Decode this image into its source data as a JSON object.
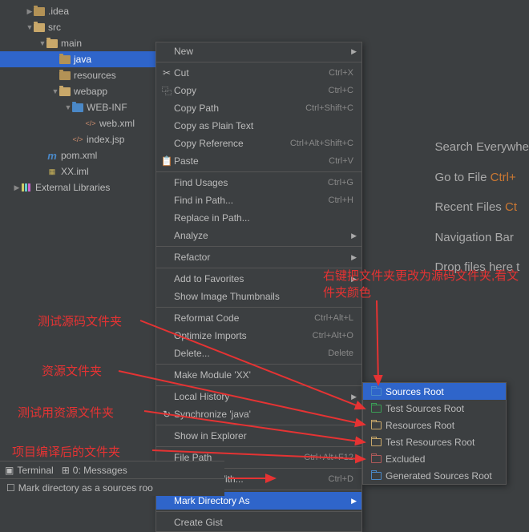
{
  "tree": [
    {
      "indent": 2,
      "chev": "▶",
      "icon": "folder-closed",
      "label": ".idea"
    },
    {
      "indent": 2,
      "chev": "▼",
      "icon": "folder",
      "label": "src"
    },
    {
      "indent": 3,
      "chev": "▼",
      "icon": "folder",
      "label": "main"
    },
    {
      "indent": 4,
      "chev": "",
      "icon": "folder-closed",
      "label": "java",
      "selected": true
    },
    {
      "indent": 4,
      "chev": "",
      "icon": "folder-closed",
      "label": "resources"
    },
    {
      "indent": 4,
      "chev": "▼",
      "icon": "folder",
      "label": "webapp"
    },
    {
      "indent": 5,
      "chev": "▼",
      "icon": "folder-blue",
      "label": "WEB-INF"
    },
    {
      "indent": 6,
      "chev": "",
      "icon": "xml",
      "label": "web.xml"
    },
    {
      "indent": 5,
      "chev": "",
      "icon": "xml",
      "label": "index.jsp"
    },
    {
      "indent": 3,
      "chev": "",
      "icon": "maven",
      "label": "pom.xml"
    },
    {
      "indent": 3,
      "chev": "",
      "icon": "iml",
      "label": "XX.iml"
    },
    {
      "indent": 1,
      "chev": "▶",
      "icon": "lib",
      "label": "External Libraries"
    }
  ],
  "menu": [
    {
      "t": "item",
      "label": "New",
      "arrow": true
    },
    {
      "t": "sep"
    },
    {
      "t": "item",
      "icon": "✂",
      "label": "Cut",
      "short": "Ctrl+X"
    },
    {
      "t": "item",
      "icon": "⿻",
      "label": "Copy",
      "short": "Ctrl+C"
    },
    {
      "t": "item",
      "label": "Copy Path",
      "short": "Ctrl+Shift+C"
    },
    {
      "t": "item",
      "label": "Copy as Plain Text"
    },
    {
      "t": "item",
      "label": "Copy Reference",
      "short": "Ctrl+Alt+Shift+C"
    },
    {
      "t": "item",
      "icon": "📋",
      "label": "Paste",
      "short": "Ctrl+V"
    },
    {
      "t": "sep"
    },
    {
      "t": "item",
      "label": "Find Usages",
      "short": "Ctrl+G"
    },
    {
      "t": "item",
      "label": "Find in Path...",
      "short": "Ctrl+H"
    },
    {
      "t": "item",
      "label": "Replace in Path..."
    },
    {
      "t": "item",
      "label": "Analyze",
      "arrow": true
    },
    {
      "t": "sep"
    },
    {
      "t": "item",
      "label": "Refactor",
      "arrow": true
    },
    {
      "t": "sep"
    },
    {
      "t": "item",
      "label": "Add to Favorites",
      "arrow": true
    },
    {
      "t": "item",
      "label": "Show Image Thumbnails"
    },
    {
      "t": "sep"
    },
    {
      "t": "item",
      "label": "Reformat Code",
      "short": "Ctrl+Alt+L"
    },
    {
      "t": "item",
      "label": "Optimize Imports",
      "short": "Ctrl+Alt+O"
    },
    {
      "t": "item",
      "label": "Delete...",
      "short": "Delete"
    },
    {
      "t": "sep"
    },
    {
      "t": "item",
      "label": "Make Module 'XX'"
    },
    {
      "t": "sep"
    },
    {
      "t": "item",
      "label": "Local History",
      "arrow": true
    },
    {
      "t": "item",
      "icon": "↻",
      "label": "Synchronize 'java'"
    },
    {
      "t": "sep"
    },
    {
      "t": "item",
      "label": "Show in Explorer"
    },
    {
      "t": "sep"
    },
    {
      "t": "item",
      "label": "File Path",
      "short": "Ctrl+Alt+F12"
    },
    {
      "t": "sep"
    },
    {
      "t": "item",
      "label": "Compare With...",
      "short": "Ctrl+D"
    },
    {
      "t": "sep"
    },
    {
      "t": "item",
      "label": "Mark Directory As",
      "arrow": true,
      "hover": true
    },
    {
      "t": "sep"
    },
    {
      "t": "item",
      "label": "Create Gist"
    }
  ],
  "submenu": [
    {
      "label": "Sources Root",
      "color": "#4a88c7",
      "hover": true
    },
    {
      "label": "Test Sources Root",
      "color": "#3b9e55"
    },
    {
      "label": "Resources Root",
      "color": "#c9a86a"
    },
    {
      "label": "Test Resources Root",
      "color": "#c9a86a"
    },
    {
      "label": "Excluded",
      "color": "#b05a5a"
    },
    {
      "label": "Generated Sources Root",
      "color": "#4a88c7"
    }
  ],
  "hints": [
    {
      "text": "Search Everywhe"
    },
    {
      "text": "Go to File ",
      "kb": "Ctrl+"
    },
    {
      "text": "Recent Files ",
      "kb": "Ct"
    },
    {
      "text": "Navigation Bar"
    },
    {
      "text": "Drop files here t"
    }
  ],
  "annotations": {
    "a1": "右键把文件夹更改为源码文件夹,看文件夹颜色",
    "a2": "测试源码文件夹",
    "a3": "资源文件夹",
    "a4": "测试用资源文件夹",
    "a5": "项目编译后的文件夹"
  },
  "bottom": {
    "terminal": "Terminal",
    "messages": "0: Messages",
    "status": "Mark directory as a sources roo"
  }
}
